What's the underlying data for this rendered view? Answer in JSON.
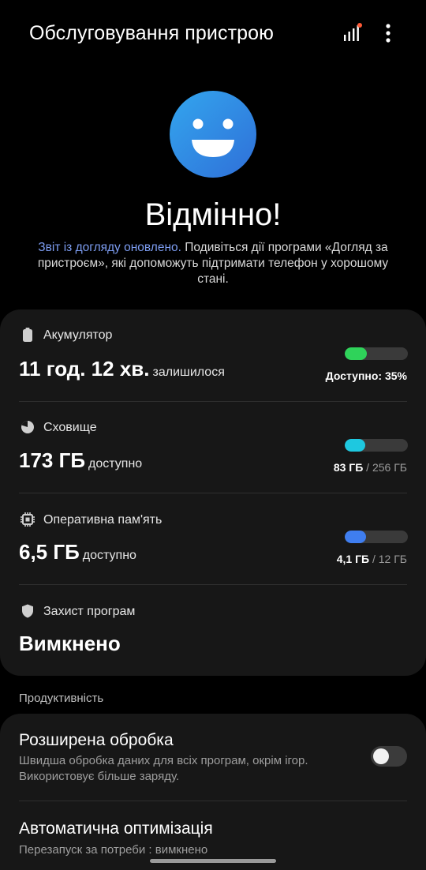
{
  "header": {
    "title": "Обслуговування пристрою",
    "stats_icon": "stats-bars-icon",
    "more_icon": "more-vertical-icon"
  },
  "hero": {
    "face_icon": "smiley-face-icon",
    "status": "Відмінно!",
    "report_link": "Звіт із догляду оновлено.",
    "report_text": " Подивіться дії програми «Догляд за пристроєм», які допоможуть підтримати телефон у хорошому стані."
  },
  "battery": {
    "label": "Акумулятор",
    "value": "11 год. 12 хв.",
    "suffix": "залишилося",
    "meta": "Доступно: 35%",
    "level": 0.35,
    "color": "#2fd35a"
  },
  "storage": {
    "label": "Сховище",
    "value": "173 ГБ",
    "suffix": "доступно",
    "used": "83 ГБ",
    "total": "256 ГБ",
    "level": 0.324,
    "color": "#1ec8e0"
  },
  "memory": {
    "label": "Оперативна пам'ять",
    "value": "6,5 ГБ",
    "suffix": "доступно",
    "used": "4,1 ГБ",
    "total": "12 ГБ",
    "level": 0.342,
    "color": "#3f7ef0"
  },
  "protection": {
    "label": "Захист програм",
    "value": "Вимкнено"
  },
  "productivity": {
    "label": "Продуктивність",
    "enhanced": {
      "title": "Розширена обробка",
      "subtitle": "Швидша обробка даних для всіх програм, окрім ігор. Використовує більше заряду.",
      "enabled": false
    },
    "auto_opt": {
      "title": "Автоматична оптимізація",
      "subtitle": "Перезапуск за потреби : вимкнено"
    }
  },
  "separators": {
    "slash": " / "
  }
}
